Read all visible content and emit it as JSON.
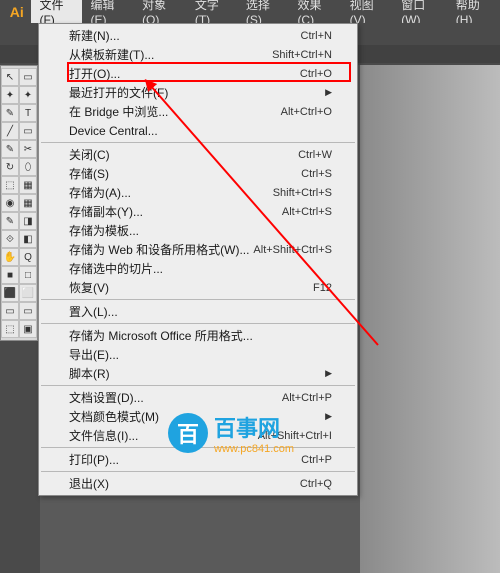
{
  "app": {
    "logo": "Ai"
  },
  "menubar": {
    "items": [
      "文件(F)",
      "编辑(E)",
      "对象(O)",
      "文字(T)",
      "选择(S)",
      "效果(C)",
      "视图(V)",
      "窗口(W)",
      "帮助(H)"
    ],
    "active_index": 0
  },
  "dropdown": {
    "groups": [
      [
        {
          "label": "新建(N)...",
          "shortcut": "Ctrl+N"
        },
        {
          "label": "从模板新建(T)...",
          "shortcut": "Shift+Ctrl+N"
        },
        {
          "label": "打开(O)...",
          "shortcut": "Ctrl+O"
        },
        {
          "label": "最近打开的文件(F)",
          "submenu": true
        },
        {
          "label": "在 Bridge 中浏览...",
          "shortcut": "Alt+Ctrl+O"
        },
        {
          "label": "Device Central..."
        }
      ],
      [
        {
          "label": "关闭(C)",
          "shortcut": "Ctrl+W"
        },
        {
          "label": "存储(S)",
          "shortcut": "Ctrl+S"
        },
        {
          "label": "存储为(A)...",
          "shortcut": "Shift+Ctrl+S"
        },
        {
          "label": "存储副本(Y)...",
          "shortcut": "Alt+Ctrl+S"
        },
        {
          "label": "存储为模板..."
        },
        {
          "label": "存储为 Web 和设备所用格式(W)...",
          "shortcut": "Alt+Shift+Ctrl+S"
        },
        {
          "label": "存储选中的切片..."
        },
        {
          "label": "恢复(V)",
          "shortcut": "F12"
        }
      ],
      [
        {
          "label": "置入(L)..."
        }
      ],
      [
        {
          "label": "存储为 Microsoft Office 所用格式..."
        },
        {
          "label": "导出(E)..."
        },
        {
          "label": "脚本(R)",
          "submenu": true
        }
      ],
      [
        {
          "label": "文档设置(D)...",
          "shortcut": "Alt+Ctrl+P"
        },
        {
          "label": "文档颜色模式(M)",
          "submenu": true
        },
        {
          "label": "文件信息(I)...",
          "shortcut": "Alt+Shift+Ctrl+I"
        }
      ],
      [
        {
          "label": "打印(P)...",
          "shortcut": "Ctrl+P"
        }
      ],
      [
        {
          "label": "退出(X)",
          "shortcut": "Ctrl+Q"
        }
      ]
    ]
  },
  "tools": {
    "rows": [
      [
        "↖",
        "▭"
      ],
      [
        "✦",
        "✦"
      ],
      [
        "✎",
        "T"
      ],
      [
        "╱",
        "▭"
      ],
      [
        "✎",
        "✂"
      ],
      [
        "↻",
        "⬯"
      ],
      [
        "⬚",
        "▦"
      ],
      [
        "◉",
        "▦"
      ],
      [
        "✎",
        "◨"
      ],
      [
        "⟐",
        "◧"
      ],
      [
        "✋",
        "Q"
      ],
      [
        "■",
        "□"
      ],
      [
        "⬛",
        "⬜"
      ],
      [
        "▭",
        "▭"
      ],
      [
        "⬚",
        "▣"
      ]
    ]
  },
  "watermark": {
    "badge": "百",
    "title": "百事网",
    "url": "www.pc841.com"
  }
}
